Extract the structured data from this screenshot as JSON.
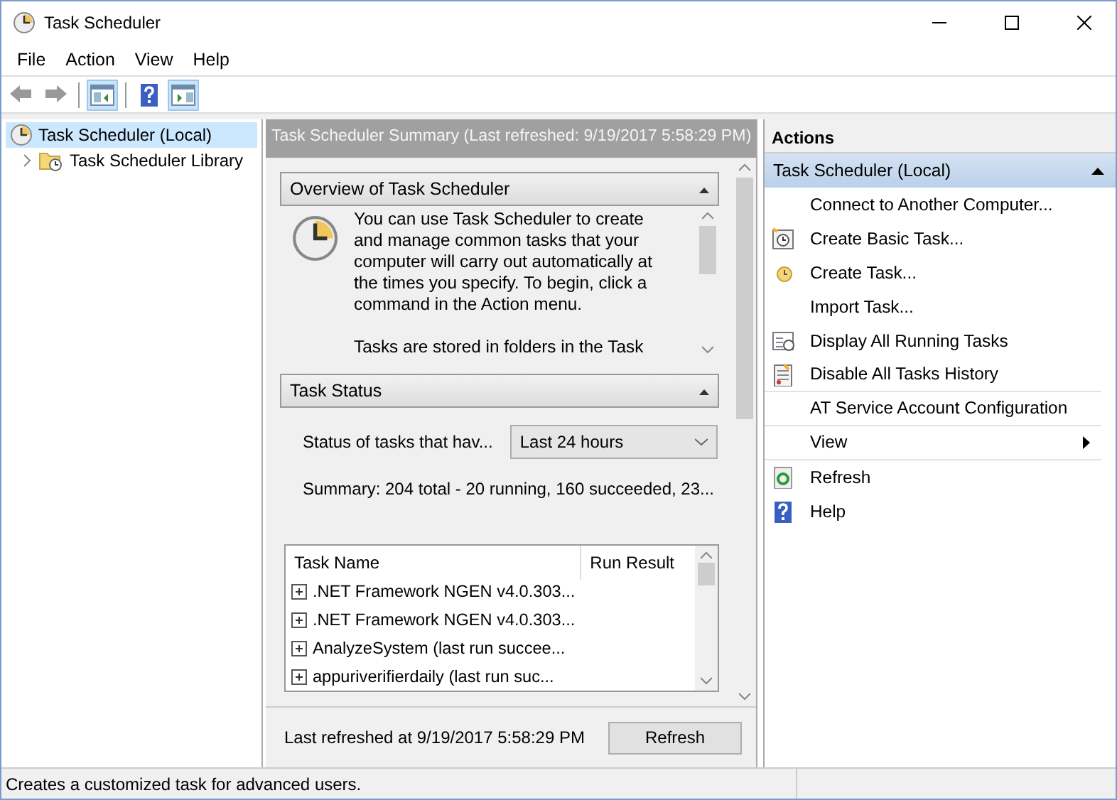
{
  "window": {
    "title": "Task Scheduler"
  },
  "menu": [
    "File",
    "Action",
    "View",
    "Help"
  ],
  "toolbar": [
    {
      "kind": "back",
      "pressed": false
    },
    {
      "kind": "forward",
      "pressed": false
    },
    {
      "kind": "tree",
      "pressed": true
    },
    {
      "kind": "help",
      "pressed": false
    },
    {
      "kind": "pane",
      "pressed": true
    }
  ],
  "tree": [
    {
      "label": "Task Scheduler (Local)",
      "selected": true,
      "children": [
        {
          "label": "Task Scheduler Library",
          "selected": false,
          "expanded": false
        }
      ]
    }
  ],
  "summary": {
    "title": "Task Scheduler Summary (Last refreshed: 9/19/2017 5:58:29 PM)",
    "overview": {
      "title": "Overview of Task Scheduler",
      "expanded": true,
      "text": "You can use Task Scheduler to create and manage common tasks that your computer will carry out automatically at the times you specify. To begin, click a command in the Action menu.",
      "text_2": "Tasks are stored in folders in the Task"
    },
    "task_status": {
      "title": "Task Status",
      "expanded": true,
      "filter_label": "Status of tasks that hav...",
      "filter_value": "Last 24 hours",
      "summary": "Summary: 204 total - 20 running, 160 succeeded, 23...",
      "columns": [
        "Task Name",
        "Run Result"
      ],
      "rows": [
        {
          "name": ".NET Framework NGEN v4.0.303..."
        },
        {
          "name": ".NET Framework NGEN v4.0.303..."
        },
        {
          "name": "AnalyzeSystem (last run succee..."
        },
        {
          "name": "appuriverifierdaily (last run suc..."
        }
      ]
    },
    "last_refreshed": "Last refreshed at 9/19/2017 5:58:29 PM",
    "refresh_button": "Refresh"
  },
  "actions": {
    "title": "Actions",
    "group": {
      "title": "Task Scheduler (Local)",
      "expanded": true
    },
    "items": [
      {
        "label": "Connect to Another Computer...",
        "kind": "plain",
        "separator_after": false
      },
      {
        "label": "Create Basic Task...",
        "kind": "calendar",
        "separator_after": false
      },
      {
        "label": "Create Task...",
        "kind": "clock",
        "separator_after": false
      },
      {
        "label": "Import Task...",
        "kind": "plain",
        "separator_after": false
      },
      {
        "label": "Display All Running Tasks",
        "kind": "list",
        "separator_after": false
      },
      {
        "label": "Disable All Tasks History",
        "kind": "history",
        "separator_after": true
      },
      {
        "label": "AT Service Account Configuration",
        "kind": "plain",
        "separator_after": true
      },
      {
        "label": "View",
        "kind": "submenu",
        "separator_after": true
      },
      {
        "label": "Refresh",
        "kind": "refresh",
        "separator_after": false
      },
      {
        "label": "Help",
        "kind": "help",
        "separator_after": false
      }
    ]
  },
  "status_bar": "Creates a customized task for advanced users."
}
